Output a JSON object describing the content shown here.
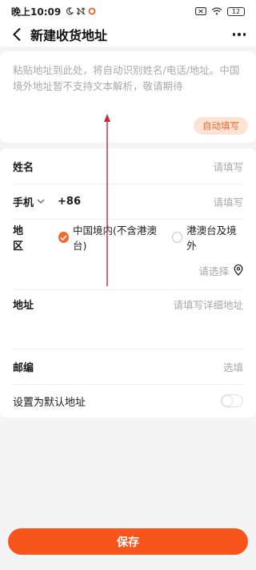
{
  "status_bar": {
    "time": "晚上10:09",
    "battery": "12"
  },
  "header": {
    "title": "新建收货地址"
  },
  "paste_area": {
    "placeholder": "粘贴地址到此处，将自动识别姓名/电话/地址。中国境外地址暂不支持文本解析，敬请期待",
    "auto_fill_label": "自动填写"
  },
  "form": {
    "name": {
      "label": "姓名",
      "placeholder": "请填写"
    },
    "phone": {
      "label": "手机",
      "country_code": "+86",
      "placeholder": "请填写"
    },
    "region": {
      "label": "地区",
      "options": [
        {
          "label": "中国境内(不含港澳台)",
          "selected": true
        },
        {
          "label": "港澳台及境外",
          "selected": false
        }
      ],
      "select_placeholder": "请选择"
    },
    "address": {
      "label": "地址",
      "placeholder": "请填写详细地址"
    },
    "postcode": {
      "label": "邮编",
      "placeholder": "选填"
    },
    "default_address": {
      "label": "设置为默认地址",
      "enabled": false
    }
  },
  "save_button": {
    "label": "保存"
  },
  "colors": {
    "accent": "#f16a31",
    "save_button": "#f8551c",
    "auto_fill_bg": "#fde3d6",
    "placeholder": "#a9a9a9",
    "annotation_arrow": "#c8283c"
  }
}
